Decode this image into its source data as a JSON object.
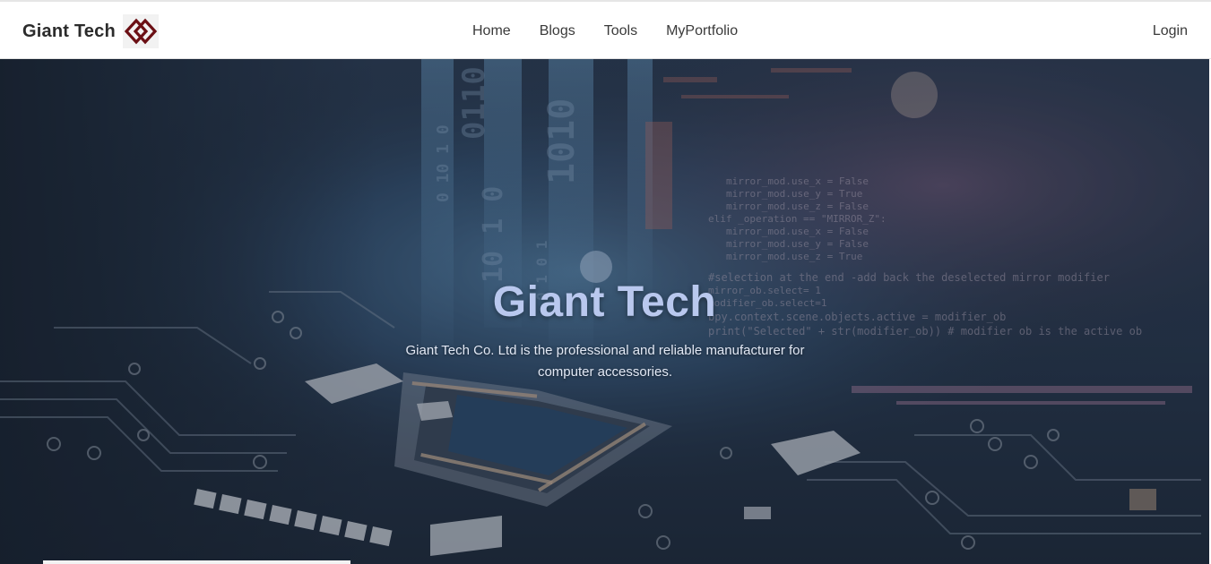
{
  "navbar": {
    "brand": "Giant Tech",
    "brand_logo_icon": "linked-diamonds-logo-icon",
    "links": [
      {
        "label": "Home"
      },
      {
        "label": "Blogs"
      },
      {
        "label": "Tools"
      },
      {
        "label": "MyPortfolio"
      }
    ],
    "login": "Login"
  },
  "hero": {
    "title": "Giant Tech",
    "subtitle": "Giant Tech Co. Ltd is the professional and reliable manufacturer for computer accessories.",
    "background_image": "circuit-board-code-background"
  },
  "colors": {
    "logo": "#6b0f14",
    "hero_title": "#b9c8ee",
    "nav_text": "#3a3a3a"
  }
}
